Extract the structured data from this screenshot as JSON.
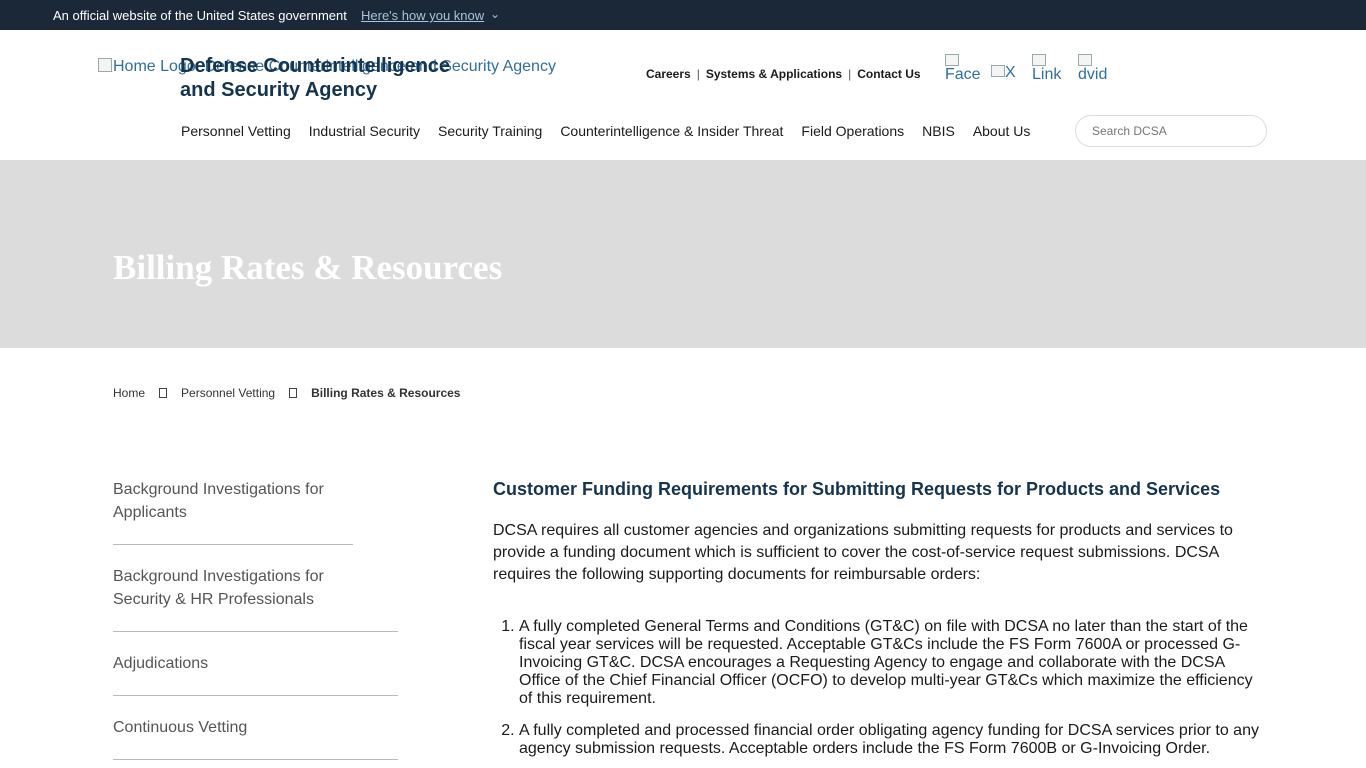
{
  "gov_banner": {
    "text": "An official website of the United States government",
    "link": "Here's how you know",
    "chevron": "⌄"
  },
  "header": {
    "logo_alt": "Home Logo: Defense Counterintelligence and Security Agency",
    "agency_name": "Defense Counterintelligence and Security Agency",
    "util_links": [
      "Careers",
      "Systems & Applications",
      "Contact Us"
    ],
    "separator": "|",
    "social": {
      "facebook": "Face",
      "x": "X",
      "linkedin": "Link",
      "dvids": "dvid"
    }
  },
  "nav": {
    "items": [
      "Personnel Vetting",
      "Industrial Security",
      "Security Training",
      "Counterintelligence & Insider Threat",
      "Field Operations",
      "NBIS",
      "About Us"
    ]
  },
  "search": {
    "placeholder": "Search DCSA"
  },
  "hero": {
    "title": "Billing Rates & Resources"
  },
  "breadcrumb": {
    "items": [
      "Home",
      "Personnel Vetting",
      "Billing Rates & Resources"
    ]
  },
  "sidebar": {
    "items": [
      "Background Investigations for Applicants",
      "Background Investigations for Security & HR Professionals",
      "Adjudications",
      "Continuous Vetting"
    ]
  },
  "content": {
    "heading": "Customer Funding Requirements for Submitting Requests for Products and Services",
    "intro": "DCSA requires all customer agencies and organizations submitting requests for products and services to provide a funding document which is sufficient to cover the cost-of-service request submissions. DCSA requires the following supporting documents for reimbursable orders:",
    "list": [
      "A fully completed General Terms and Conditions (GT&C) on file with DCSA no later than the start of the fiscal year services will be requested.  Acceptable GT&Cs include the FS Form 7600A or processed G-Invoicing GT&C.  DCSA encourages a Requesting Agency to engage and collaborate with the DCSA Office of the Chief Financial Officer (OCFO) to develop multi-year GT&Cs which maximize the efficiency of this requirement.",
      "A fully completed and processed financial order obligating agency funding for DCSA services prior to any agency submission requests.  Acceptable orders include the FS Form 7600B or G-Invoicing Order."
    ]
  }
}
